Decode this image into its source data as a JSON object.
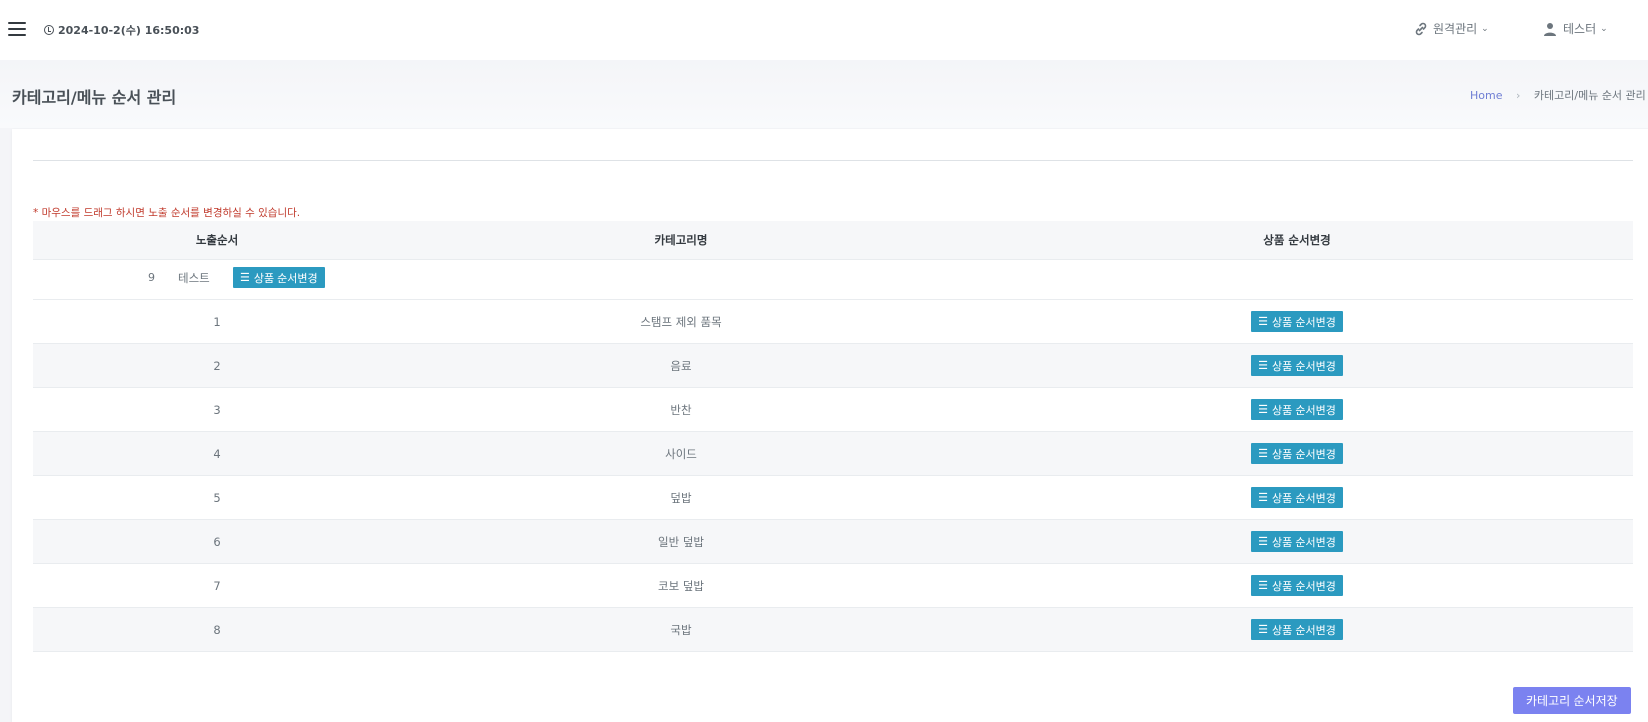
{
  "header": {
    "datetime": "2024-10-2(수) 16:50:03",
    "remote_menu": "원격관리",
    "user_menu": "테스터"
  },
  "page": {
    "title": "카테고리/메뉴 순서 관리",
    "breadcrumb_home": "Home",
    "breadcrumb_current": "카테고리/메뉴 순서 관리"
  },
  "notice": "* 마우스를 드래그 하시면 노출 순서를 변경하실 수 있습니다.",
  "table": {
    "headers": {
      "order": "노출순서",
      "name": "카테고리명",
      "change": "상품 순서변경"
    },
    "dragging_row": {
      "order": "9",
      "name": "테스트",
      "button": "상품 순서변경"
    },
    "rows": [
      {
        "order": "1",
        "name": "스탬프 제외 품목",
        "button": "상품 순서변경"
      },
      {
        "order": "2",
        "name": "음료",
        "button": "상품 순서변경"
      },
      {
        "order": "3",
        "name": "반찬",
        "button": "상품 순서변경"
      },
      {
        "order": "4",
        "name": "사이드",
        "button": "상품 순서변경"
      },
      {
        "order": "5",
        "name": "덮밥",
        "button": "상품 순서변경"
      },
      {
        "order": "6",
        "name": "일반 덮밥",
        "button": "상품 순서변경"
      },
      {
        "order": "7",
        "name": "코보 덮밥",
        "button": "상품 순서변경"
      },
      {
        "order": "8",
        "name": "국밥",
        "button": "상품 순서변경"
      }
    ]
  },
  "save_button": "카테고리 순서저장",
  "colors": {
    "accent_button": "#2b9ac0",
    "save_button": "#7b82f0",
    "notice": "#c0392b",
    "breadcrumb_link": "#6f7ed4"
  },
  "icons": {
    "menu": "hamburger-icon",
    "clock": "clock-icon",
    "remote": "link-icon",
    "user": "user-icon",
    "list": "bars-icon"
  }
}
